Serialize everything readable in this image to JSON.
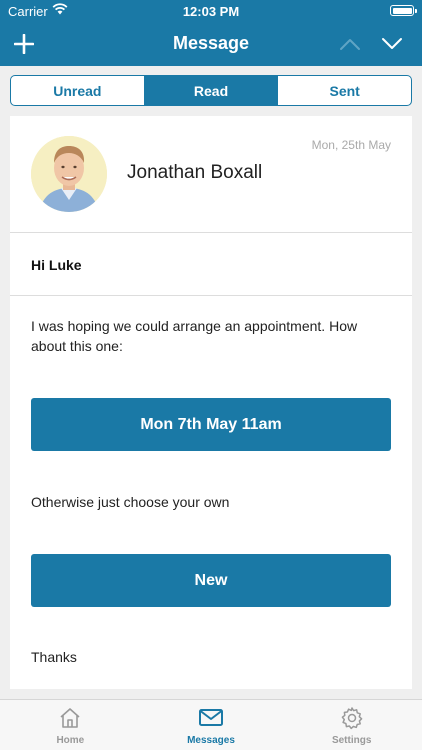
{
  "status_bar": {
    "carrier": "Carrier",
    "time": "12:03 PM"
  },
  "nav_bar": {
    "title": "Message",
    "icons": [
      "plus-icon",
      "chevron-up-icon",
      "chevron-down-icon"
    ]
  },
  "segments": {
    "items": [
      {
        "label": "Unread",
        "active": false
      },
      {
        "label": "Read",
        "active": true
      },
      {
        "label": "Sent",
        "active": false
      }
    ]
  },
  "message": {
    "sender": "Jonathan Boxall",
    "date": "Mon, 25th May",
    "greeting": "Hi Luke",
    "paragraph1": "I was hoping we could arrange an appointment.  How about this one:",
    "appointment_button": "Mon 7th May 11am",
    "paragraph2": "Otherwise just choose your own",
    "new_button": "New",
    "closing": "Thanks"
  },
  "tab_bar": {
    "items": [
      {
        "label": "Home",
        "icon": "home-icon",
        "active": false
      },
      {
        "label": "Messages",
        "icon": "envelope-icon",
        "active": true
      },
      {
        "label": "Settings",
        "icon": "gear-icon",
        "active": false
      }
    ]
  },
  "colors": {
    "brand": "#1a79a6",
    "background": "#efefef",
    "inactive_tab": "#999999"
  }
}
